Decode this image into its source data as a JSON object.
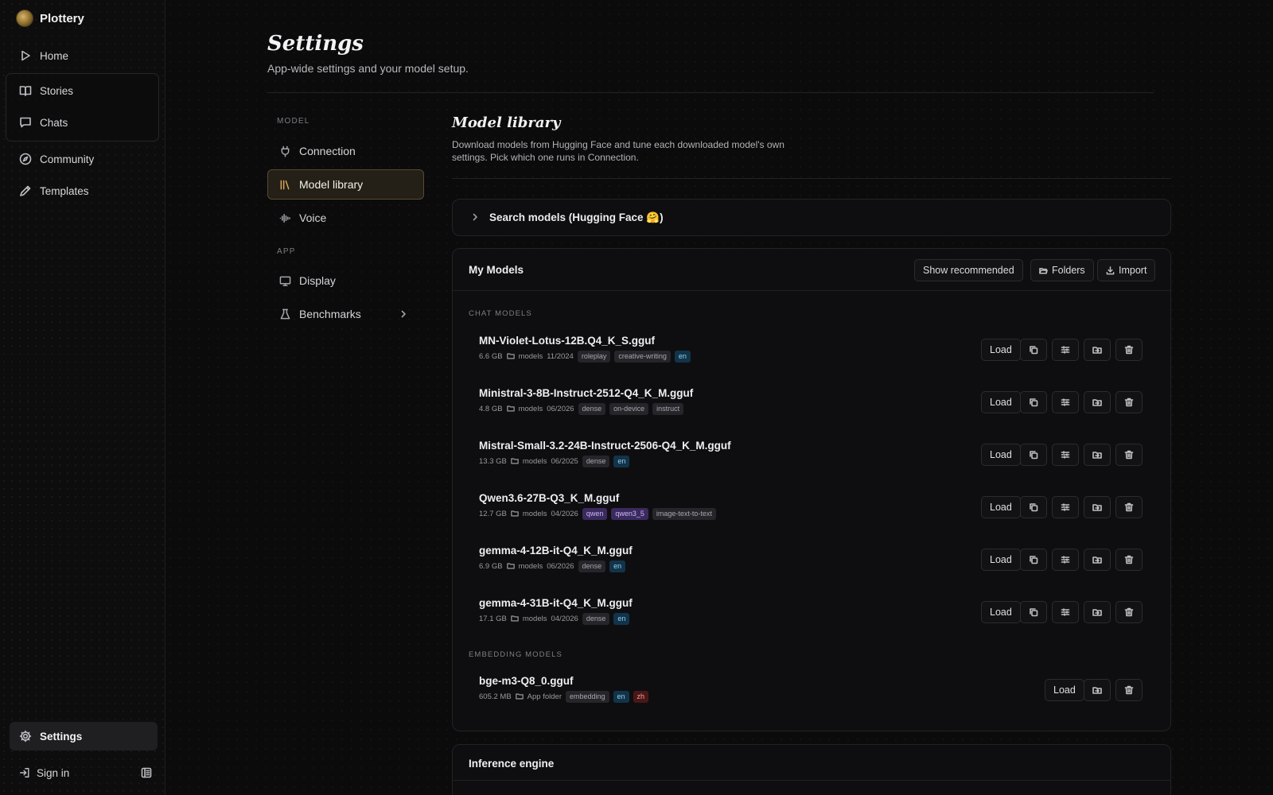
{
  "app": {
    "name": "Plottery"
  },
  "sidebar": {
    "items": [
      {
        "label": "Home",
        "icon": "play-icon"
      },
      {
        "label": "Stories",
        "icon": "book-icon"
      },
      {
        "label": "Chats",
        "icon": "chat-icon"
      },
      {
        "label": "Community",
        "icon": "compass-icon"
      },
      {
        "label": "Templates",
        "icon": "pencil-icon"
      }
    ],
    "settings_label": "Settings",
    "signin_label": "Sign in"
  },
  "page": {
    "title": "Settings",
    "subtitle": "App-wide settings and your model setup."
  },
  "settings_nav": {
    "sections": [
      {
        "label": "MODEL",
        "items": [
          "Connection",
          "Model library",
          "Voice"
        ]
      },
      {
        "label": "APP",
        "items": [
          "Display",
          "Benchmarks"
        ]
      }
    ],
    "active": "Model library"
  },
  "content": {
    "title": "Model library",
    "description": "Download models from Hugging Face and tune each downloaded model's own settings. Pick which one runs in Connection.",
    "search_label": "Search models (Hugging Face 🤗)",
    "my_models": {
      "title": "My Models",
      "buttons": {
        "recommended": "Show recommended",
        "folders": "Folders",
        "import": "Import"
      },
      "chat_section_label": "CHAT MODELS",
      "chat_models": [
        {
          "name": "MN-Violet-Lotus-12B.Q4_K_S.gguf",
          "size": "6.6 GB",
          "folder": "models",
          "date": "11/2024",
          "tags": [
            {
              "t": "roleplay",
              "c": "gray"
            },
            {
              "t": "creative-writing",
              "c": "gray"
            },
            {
              "t": "en",
              "c": "blue"
            }
          ]
        },
        {
          "name": "Ministral-3-8B-Instruct-2512-Q4_K_M.gguf",
          "size": "4.8 GB",
          "folder": "models",
          "date": "06/2026",
          "tags": [
            {
              "t": "dense",
              "c": "gray"
            },
            {
              "t": "on-device",
              "c": "gray"
            },
            {
              "t": "instruct",
              "c": "gray"
            }
          ]
        },
        {
          "name": "Mistral-Small-3.2-24B-Instruct-2506-Q4_K_M.gguf",
          "size": "13.3 GB",
          "folder": "models",
          "date": "06/2025",
          "tags": [
            {
              "t": "dense",
              "c": "gray"
            },
            {
              "t": "en",
              "c": "blue"
            }
          ]
        },
        {
          "name": "Qwen3.6-27B-Q3_K_M.gguf",
          "size": "12.7 GB",
          "folder": "models",
          "date": "04/2026",
          "tags": [
            {
              "t": "qwen",
              "c": "purple"
            },
            {
              "t": "qwen3_5",
              "c": "purple"
            },
            {
              "t": "image-text-to-text",
              "c": "gray"
            }
          ]
        },
        {
          "name": "gemma-4-12B-it-Q4_K_M.gguf",
          "size": "6.9 GB",
          "folder": "models",
          "date": "06/2026",
          "tags": [
            {
              "t": "dense",
              "c": "gray"
            },
            {
              "t": "en",
              "c": "blue"
            }
          ]
        },
        {
          "name": "gemma-4-31B-it-Q4_K_M.gguf",
          "size": "17.1 GB",
          "folder": "models",
          "date": "04/2026",
          "tags": [
            {
              "t": "dense",
              "c": "gray"
            },
            {
              "t": "en",
              "c": "blue"
            }
          ]
        }
      ],
      "embedding_section_label": "EMBEDDING MODELS",
      "embedding_models": [
        {
          "name": "bge-m3-Q8_0.gguf",
          "size": "605.2 MB",
          "folder": "App folder",
          "tags": [
            {
              "t": "embedding",
              "c": "gray"
            },
            {
              "t": "en",
              "c": "blue"
            },
            {
              "t": "zh",
              "c": "red"
            }
          ]
        }
      ],
      "load_label": "Load"
    },
    "inference_engine_title": "Inference engine"
  },
  "colors": {
    "accent": "#d7a85c",
    "active_bg": "#241f17",
    "tag_blue": "#12344a",
    "tag_purple": "#3a2a5e",
    "tag_red": "#4a1717"
  }
}
